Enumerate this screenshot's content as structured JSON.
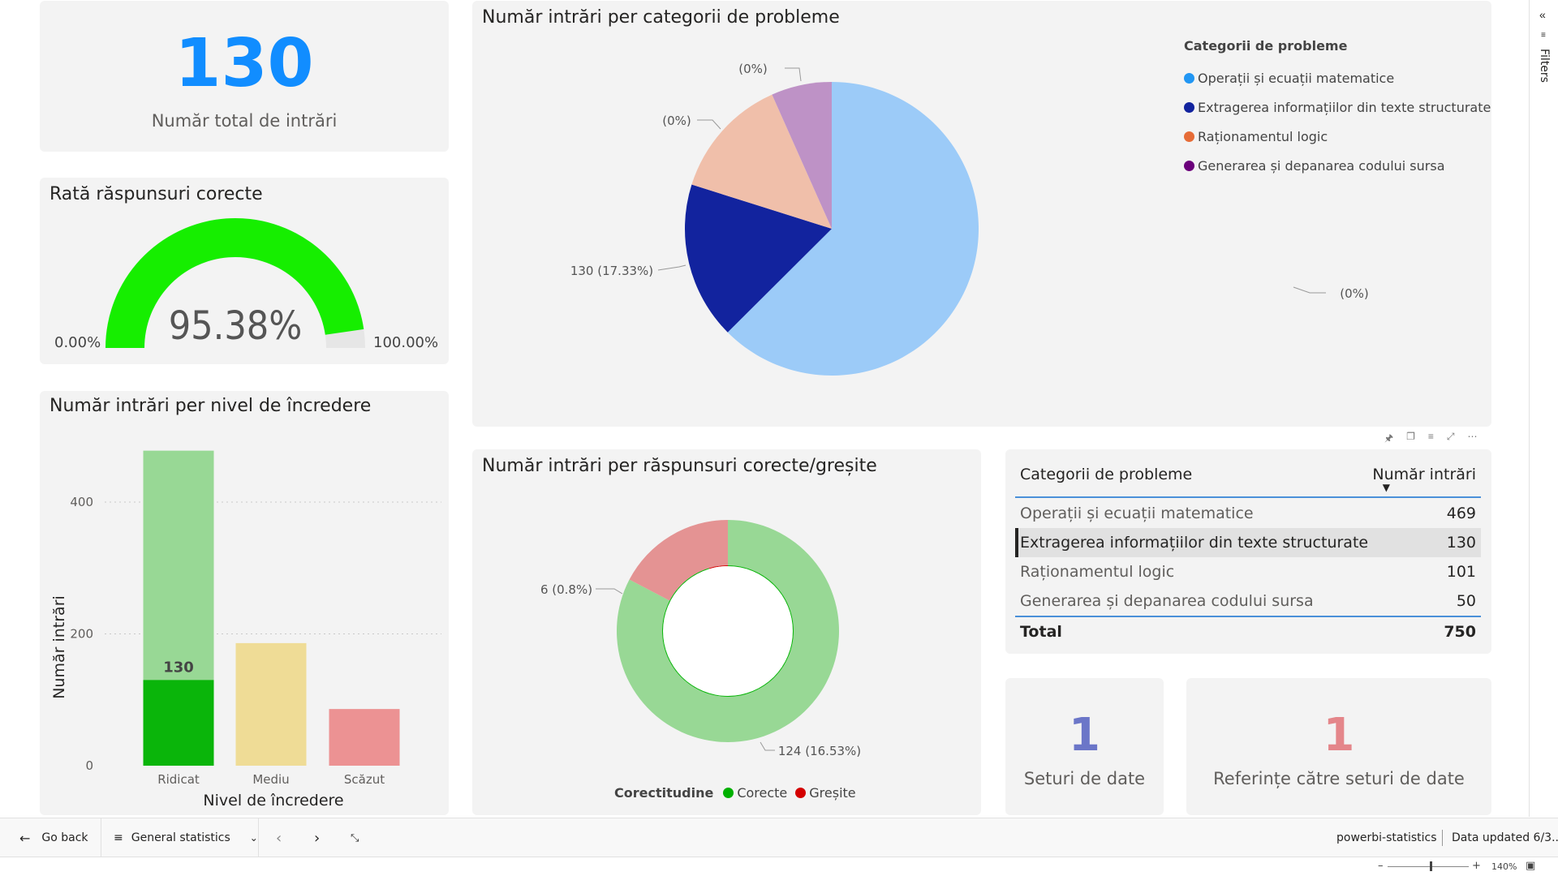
{
  "kpi_total": {
    "value": "130",
    "label": "Număr total de intrări"
  },
  "gauge": {
    "title": "Rată răspunsuri corecte",
    "value_label": "95.38%",
    "value": 95.38,
    "min_label": "0.00%",
    "max_label": "100.00%",
    "fill_color": "#16ee00"
  },
  "pie": {
    "title": "Număr intrări per categorii de probleme",
    "legend_title": "Categorii de probleme",
    "legend": [
      {
        "label": "Operații și ecuații matematice",
        "color": "#2196f3"
      },
      {
        "label": "Extragerea informațiilor din texte structurate",
        "color": "#12239e"
      },
      {
        "label": "Raționamentul logic",
        "color": "#e66c37"
      },
      {
        "label": "Generarea și depanarea codului sursa",
        "color": "#6b007b"
      }
    ],
    "labels": {
      "math": "(0%)",
      "extract": "130 (17.33%)",
      "logic": "(0%)",
      "code": "(0%)"
    }
  },
  "bar": {
    "title": "Număr intrări per nivel de încredere",
    "ylabel": "Număr intrări",
    "xlabel": "Nivel de încredere",
    "highlight_label": "130",
    "ticks": [
      "0",
      "200",
      "400"
    ]
  },
  "donut": {
    "title": "Număr intrări per răspunsuri corecte/greșite",
    "label_wrong": "6 (0.8%)",
    "label_correct": "124 (16.53%)",
    "legend_title": "Corectitudine",
    "legend": [
      {
        "label": "Corecte",
        "color": "#00b000"
      },
      {
        "label": "Greșite",
        "color": "#d40000"
      }
    ]
  },
  "table": {
    "col1": "Categorii de probleme",
    "col2": "Număr intrări",
    "rows": [
      {
        "name": "Operații și ecuații matematice",
        "value": "469"
      },
      {
        "name": "Extragerea informațiilor din texte structurate",
        "value": "130"
      },
      {
        "name": "Raționamentul logic",
        "value": "101"
      },
      {
        "name": "Generarea și depanarea codului sursa",
        "value": "50"
      }
    ],
    "total_label": "Total",
    "total_value": "750"
  },
  "kpi_datasets": {
    "value": "1",
    "label": "Seturi de date"
  },
  "kpi_refs": {
    "value": "1",
    "label": "Referințe către seturi de date"
  },
  "bottombar": {
    "back": "Go back",
    "page_name": "General statistics",
    "report_name": "powerbi-statistics",
    "updated": "Data updated 6/3...",
    "zoom": "140%"
  },
  "filters": {
    "label": "Filters"
  },
  "chart_data": [
    {
      "type": "pie",
      "title": "Număr intrări per categorii de probleme",
      "categories": [
        "Operații și ecuații matematice",
        "Extragerea informațiilor din texte structurate",
        "Raționamentul logic",
        "Generarea și depanarea codului sursa"
      ],
      "values": [
        469,
        130,
        101,
        50
      ],
      "highlighted": [
        0,
        130,
        0,
        0
      ],
      "data_labels": [
        "(0%)",
        "130 (17.33%)",
        "(0%)",
        "(0%)"
      ],
      "colors": [
        "#9ccbf8",
        "#12239e",
        "#f0bfaa",
        "#be92c6"
      ],
      "legend": "top-right"
    },
    {
      "type": "bar",
      "title": "Număr intrări per nivel de încredere",
      "categories": [
        "Ridicat",
        "Mediu",
        "Scăzut"
      ],
      "series": [
        {
          "name": "total",
          "values": [
            478,
            186,
            86
          ]
        },
        {
          "name": "highlighted",
          "values": [
            130,
            0,
            0
          ]
        }
      ],
      "xlabel": "Nivel de încredere",
      "ylabel": "Număr intrări",
      "ylim": [
        0,
        480
      ],
      "yticks": [
        0,
        200,
        400
      ],
      "grid": true
    },
    {
      "type": "pie",
      "subtype": "donut",
      "title": "Număr intrări per răspunsuri corecte/greșite",
      "categories": [
        "Corecte",
        "Greșite"
      ],
      "values": [
        620,
        130
      ],
      "highlighted": [
        124,
        6
      ],
      "data_labels": [
        "124 (16.53%)",
        "6 (0.8%)"
      ],
      "legend": "bottom"
    }
  ]
}
